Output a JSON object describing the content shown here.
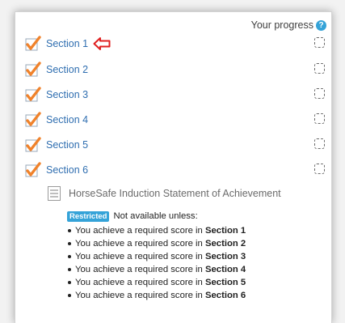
{
  "header": {
    "progress_label": "Your progress",
    "help_icon": "?"
  },
  "sections": [
    {
      "label": "Section 1",
      "completed": false
    },
    {
      "label": "Section 2",
      "completed": false
    },
    {
      "label": "Section 3",
      "completed": false
    },
    {
      "label": "Section 4",
      "completed": false
    },
    {
      "label": "Section 5",
      "completed": false
    },
    {
      "label": "Section 6",
      "completed": false
    }
  ],
  "activity": {
    "name": "HorseSafe Induction Statement of Achievement",
    "icon": "document-icon"
  },
  "restriction": {
    "badge": "Restricted",
    "text": "Not available unless:",
    "condition_prefix": "You achieve a required score in",
    "conditions": [
      "Section 1",
      "Section 2",
      "Section 3",
      "Section 4",
      "Section 5",
      "Section 6"
    ]
  },
  "colors": {
    "link": "#2f6eb0",
    "check": "#f0822b",
    "highlight_arrow": "#e02020",
    "badge": "#35a3d8"
  }
}
